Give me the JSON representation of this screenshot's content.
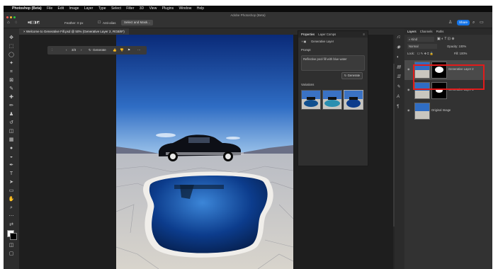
{
  "menubar": {
    "app_name": "Photoshop (Beta)",
    "items": [
      "File",
      "Edit",
      "Image",
      "Layer",
      "Type",
      "Select",
      "Filter",
      "3D",
      "View",
      "Plugins",
      "Window",
      "Help"
    ]
  },
  "window": {
    "title": "Adobe Photoshop (Beta)"
  },
  "options_bar": {
    "feather": "Feather: 0 px",
    "anti_alias": "Anti-alias",
    "select_mask": "Select and Mask...",
    "share": "Share"
  },
  "document": {
    "tab_title": "Welcome to Generative Fill.psd @ 50% (Generative Layer 2, RGB/8*)"
  },
  "context_bar": {
    "counter": "3/3",
    "generate": "Generate"
  },
  "properties_panel": {
    "tabs": [
      "Properties",
      "Layer Comps"
    ],
    "layer_type": "Generative Layer",
    "prompt_label": "Prompt",
    "prompt_text": "Reflective pool fill with blue water",
    "generate": "Generate",
    "variations_label": "Variations"
  },
  "layers_panel": {
    "tabs": [
      "Layers",
      "Channels",
      "Paths"
    ],
    "filter_kind": "Kind",
    "blend_mode": "Normal",
    "opacity": "Opacity: 100%",
    "lock_label": "Lock:",
    "fill": "Fill: 100%",
    "layers": [
      {
        "name": "Generative Layer 2",
        "selected": true
      },
      {
        "name": "Generative Layer 1",
        "selected": false
      },
      {
        "name": "Original Image",
        "selected": false
      }
    ]
  },
  "colors": {
    "highlight_box": "#e21b1b",
    "share_button": "#1473e6"
  }
}
